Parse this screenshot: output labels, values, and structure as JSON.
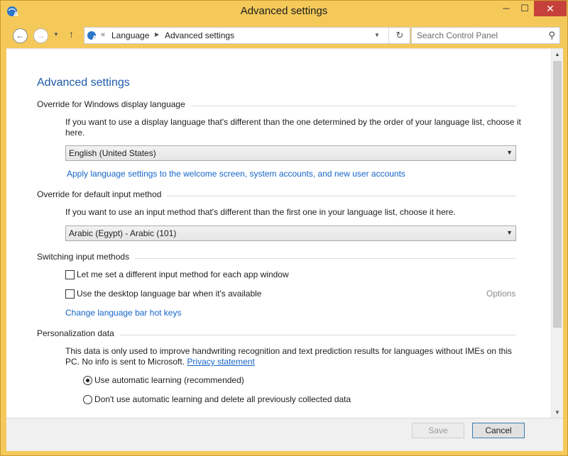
{
  "window": {
    "title": "Advanced settings",
    "minimize": "─",
    "maximize": "☐",
    "close": "✕"
  },
  "nav": {
    "back": "←",
    "forward": "→",
    "recent": "▼",
    "up": "↑",
    "breadcrumb": [
      "Language",
      "Advanced settings"
    ],
    "separator": "▶",
    "overflow": "«",
    "dropdown": "▼",
    "refresh": "↻",
    "search_placeholder": "Search Control Panel",
    "search_glyph": "⚲"
  },
  "page": {
    "title": "Advanced settings"
  },
  "display_language": {
    "heading": "Override for Windows display language",
    "description": "If you want to use a display language that's different than the one determined by the order of your language list, choose it here.",
    "selected": "English (United States)",
    "apply_link": "Apply language settings to the welcome screen, system accounts, and new user accounts"
  },
  "input_method": {
    "heading": "Override for default input method",
    "description": "If you want to use an input method that's different than the first one in your language list, choose it here.",
    "selected": "Arabic (Egypt) - Arabic (101)"
  },
  "switching": {
    "heading": "Switching input methods",
    "per_app_label": "Let me set a different input method for each app window",
    "per_app_checked": false,
    "language_bar_label": "Use the desktop language bar when it's available",
    "language_bar_checked": false,
    "options_link": "Options",
    "hotkeys_link": "Change language bar hot keys"
  },
  "personalization": {
    "heading": "Personalization data",
    "description": "This data is only used to improve handwriting recognition and text prediction results for languages without IMEs on this PC. No info is sent to Microsoft.",
    "privacy_link": "Privacy statement",
    "option_auto": "Use automatic learning (recommended)",
    "option_no_auto": "Don't use automatic learning and delete all previously collected data",
    "selected": "auto"
  },
  "footer": {
    "save": "Save",
    "cancel": "Cancel"
  },
  "colors": {
    "frame": "#f4c95a",
    "link": "#1565c8",
    "title": "#1e5aa8",
    "close_button": "#c7413b"
  }
}
